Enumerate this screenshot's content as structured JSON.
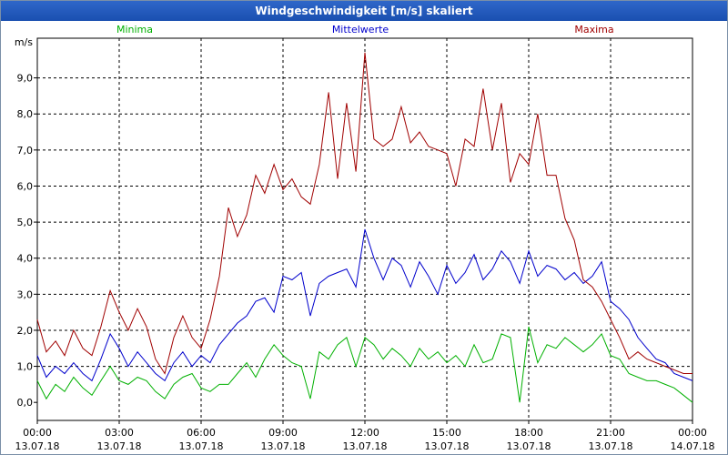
{
  "window": {
    "title": "Windgeschwindigkeit [m/s] skaliert"
  },
  "chart_data": {
    "type": "line",
    "title": "Windgeschwindigkeit [m/s] skaliert",
    "ylabel": "m/s",
    "xlabel": "",
    "ylim": [
      -0.5,
      10.1
    ],
    "yticks": [
      "0,0",
      "1,0",
      "2,0",
      "3,0",
      "4,0",
      "5,0",
      "6,0",
      "7,0",
      "8,0",
      "9,0"
    ],
    "xticks": [
      {
        "time": "00:00",
        "date": "13.07.18"
      },
      {
        "time": "03:00",
        "date": "13.07.18"
      },
      {
        "time": "06:00",
        "date": "13.07.18"
      },
      {
        "time": "09:00",
        "date": "13.07.18"
      },
      {
        "time": "12:00",
        "date": "13.07.18"
      },
      {
        "time": "15:00",
        "date": "13.07.18"
      },
      {
        "time": "18:00",
        "date": "13.07.18"
      },
      {
        "time": "21:00",
        "date": "13.07.18"
      },
      {
        "time": "00:00",
        "date": "14.07.18"
      }
    ],
    "x_unit": "hours since 13.07.18 00:00",
    "grid": true,
    "legend_position": "top",
    "series": [
      {
        "name": "Minima",
        "color": "#00b000",
        "x": [
          0,
          0.33,
          0.67,
          1,
          1.33,
          1.67,
          2,
          2.33,
          2.67,
          3,
          3.33,
          3.67,
          4,
          4.33,
          4.67,
          5,
          5.33,
          5.67,
          6,
          6.33,
          6.67,
          7,
          7.33,
          7.67,
          8,
          8.33,
          8.67,
          9,
          9.33,
          9.67,
          10,
          10.33,
          10.67,
          11,
          11.33,
          11.67,
          12,
          12.33,
          12.67,
          13,
          13.33,
          13.67,
          14,
          14.33,
          14.67,
          15,
          15.33,
          15.67,
          16,
          16.33,
          16.67,
          17,
          17.33,
          17.67,
          18,
          18.33,
          18.67,
          19,
          19.33,
          19.67,
          20,
          20.33,
          20.67,
          21,
          21.33,
          21.67,
          22,
          22.33,
          22.67,
          23,
          23.33,
          23.67,
          24
        ],
        "values": [
          0.6,
          0.1,
          0.5,
          0.3,
          0.7,
          0.4,
          0.2,
          0.6,
          1.0,
          0.6,
          0.5,
          0.7,
          0.6,
          0.3,
          0.1,
          0.5,
          0.7,
          0.8,
          0.4,
          0.3,
          0.5,
          0.5,
          0.8,
          1.1,
          0.7,
          1.2,
          1.6,
          1.3,
          1.1,
          1.0,
          0.1,
          1.4,
          1.2,
          1.6,
          1.8,
          1.0,
          1.8,
          1.6,
          1.2,
          1.5,
          1.3,
          1.0,
          1.5,
          1.2,
          1.4,
          1.1,
          1.3,
          1.0,
          1.6,
          1.1,
          1.2,
          1.9,
          1.8,
          0.0,
          2.1,
          1.1,
          1.6,
          1.5,
          1.8,
          1.6,
          1.4,
          1.6,
          1.9,
          1.3,
          1.2,
          0.8,
          0.7,
          0.6,
          0.6,
          0.5,
          0.4,
          0.2,
          0.0
        ]
      },
      {
        "name": "Mittelwerte",
        "color": "#0000cc",
        "x": [
          0,
          0.33,
          0.67,
          1,
          1.33,
          1.67,
          2,
          2.33,
          2.67,
          3,
          3.33,
          3.67,
          4,
          4.33,
          4.67,
          5,
          5.33,
          5.67,
          6,
          6.33,
          6.67,
          7,
          7.33,
          7.67,
          8,
          8.33,
          8.67,
          9,
          9.33,
          9.67,
          10,
          10.33,
          10.67,
          11,
          11.33,
          11.67,
          12,
          12.33,
          12.67,
          13,
          13.33,
          13.67,
          14,
          14.33,
          14.67,
          15,
          15.33,
          15.67,
          16,
          16.33,
          16.67,
          17,
          17.33,
          17.67,
          18,
          18.33,
          18.67,
          19,
          19.33,
          19.67,
          20,
          20.33,
          20.67,
          21,
          21.33,
          21.67,
          22,
          22.33,
          22.67,
          23,
          23.33,
          23.67,
          24
        ],
        "values": [
          1.3,
          0.7,
          1.0,
          0.8,
          1.1,
          0.8,
          0.6,
          1.2,
          1.9,
          1.5,
          1.0,
          1.4,
          1.1,
          0.8,
          0.6,
          1.1,
          1.4,
          1.0,
          1.3,
          1.1,
          1.6,
          1.9,
          2.2,
          2.4,
          2.8,
          2.9,
          2.5,
          3.5,
          3.4,
          3.6,
          2.4,
          3.3,
          3.5,
          3.6,
          3.7,
          3.2,
          4.8,
          4.0,
          3.4,
          4.0,
          3.8,
          3.2,
          3.9,
          3.5,
          3.0,
          3.8,
          3.3,
          3.6,
          4.1,
          3.4,
          3.7,
          4.2,
          3.9,
          3.3,
          4.2,
          3.5,
          3.8,
          3.7,
          3.4,
          3.6,
          3.3,
          3.5,
          3.9,
          2.8,
          2.6,
          2.3,
          1.8,
          1.5,
          1.2,
          1.1,
          0.8,
          0.7,
          0.6
        ]
      },
      {
        "name": "Maxima",
        "color": "#a00000",
        "x": [
          0,
          0.33,
          0.67,
          1,
          1.33,
          1.67,
          2,
          2.33,
          2.67,
          3,
          3.33,
          3.67,
          4,
          4.33,
          4.67,
          5,
          5.33,
          5.67,
          6,
          6.33,
          6.67,
          7,
          7.33,
          7.67,
          8,
          8.33,
          8.67,
          9,
          9.33,
          9.67,
          10,
          10.33,
          10.67,
          11,
          11.33,
          11.67,
          12,
          12.33,
          12.67,
          13,
          13.33,
          13.67,
          14,
          14.33,
          14.67,
          15,
          15.33,
          15.67,
          16,
          16.33,
          16.67,
          17,
          17.33,
          17.67,
          18,
          18.33,
          18.67,
          19,
          19.33,
          19.67,
          20,
          20.33,
          20.67,
          21,
          21.33,
          21.67,
          22,
          22.33,
          22.67,
          23,
          23.33,
          23.67,
          24
        ],
        "values": [
          2.3,
          1.4,
          1.7,
          1.3,
          2.0,
          1.5,
          1.3,
          2.1,
          3.1,
          2.5,
          2.0,
          2.6,
          2.1,
          1.2,
          0.8,
          1.8,
          2.4,
          1.8,
          1.5,
          2.3,
          3.5,
          5.4,
          4.6,
          5.2,
          6.3,
          5.8,
          6.6,
          5.9,
          6.2,
          5.7,
          5.5,
          6.6,
          8.6,
          6.2,
          8.3,
          6.4,
          9.7,
          7.3,
          7.1,
          7.3,
          8.2,
          7.2,
          7.5,
          7.1,
          7.0,
          6.9,
          6.0,
          7.3,
          7.1,
          8.7,
          7.0,
          8.3,
          6.1,
          6.9,
          6.6,
          8.0,
          6.3,
          6.3,
          5.1,
          4.5,
          3.4,
          3.2,
          2.8,
          2.3,
          1.8,
          1.2,
          1.4,
          1.2,
          1.1,
          1.0,
          0.9,
          0.8,
          0.8
        ]
      }
    ]
  }
}
